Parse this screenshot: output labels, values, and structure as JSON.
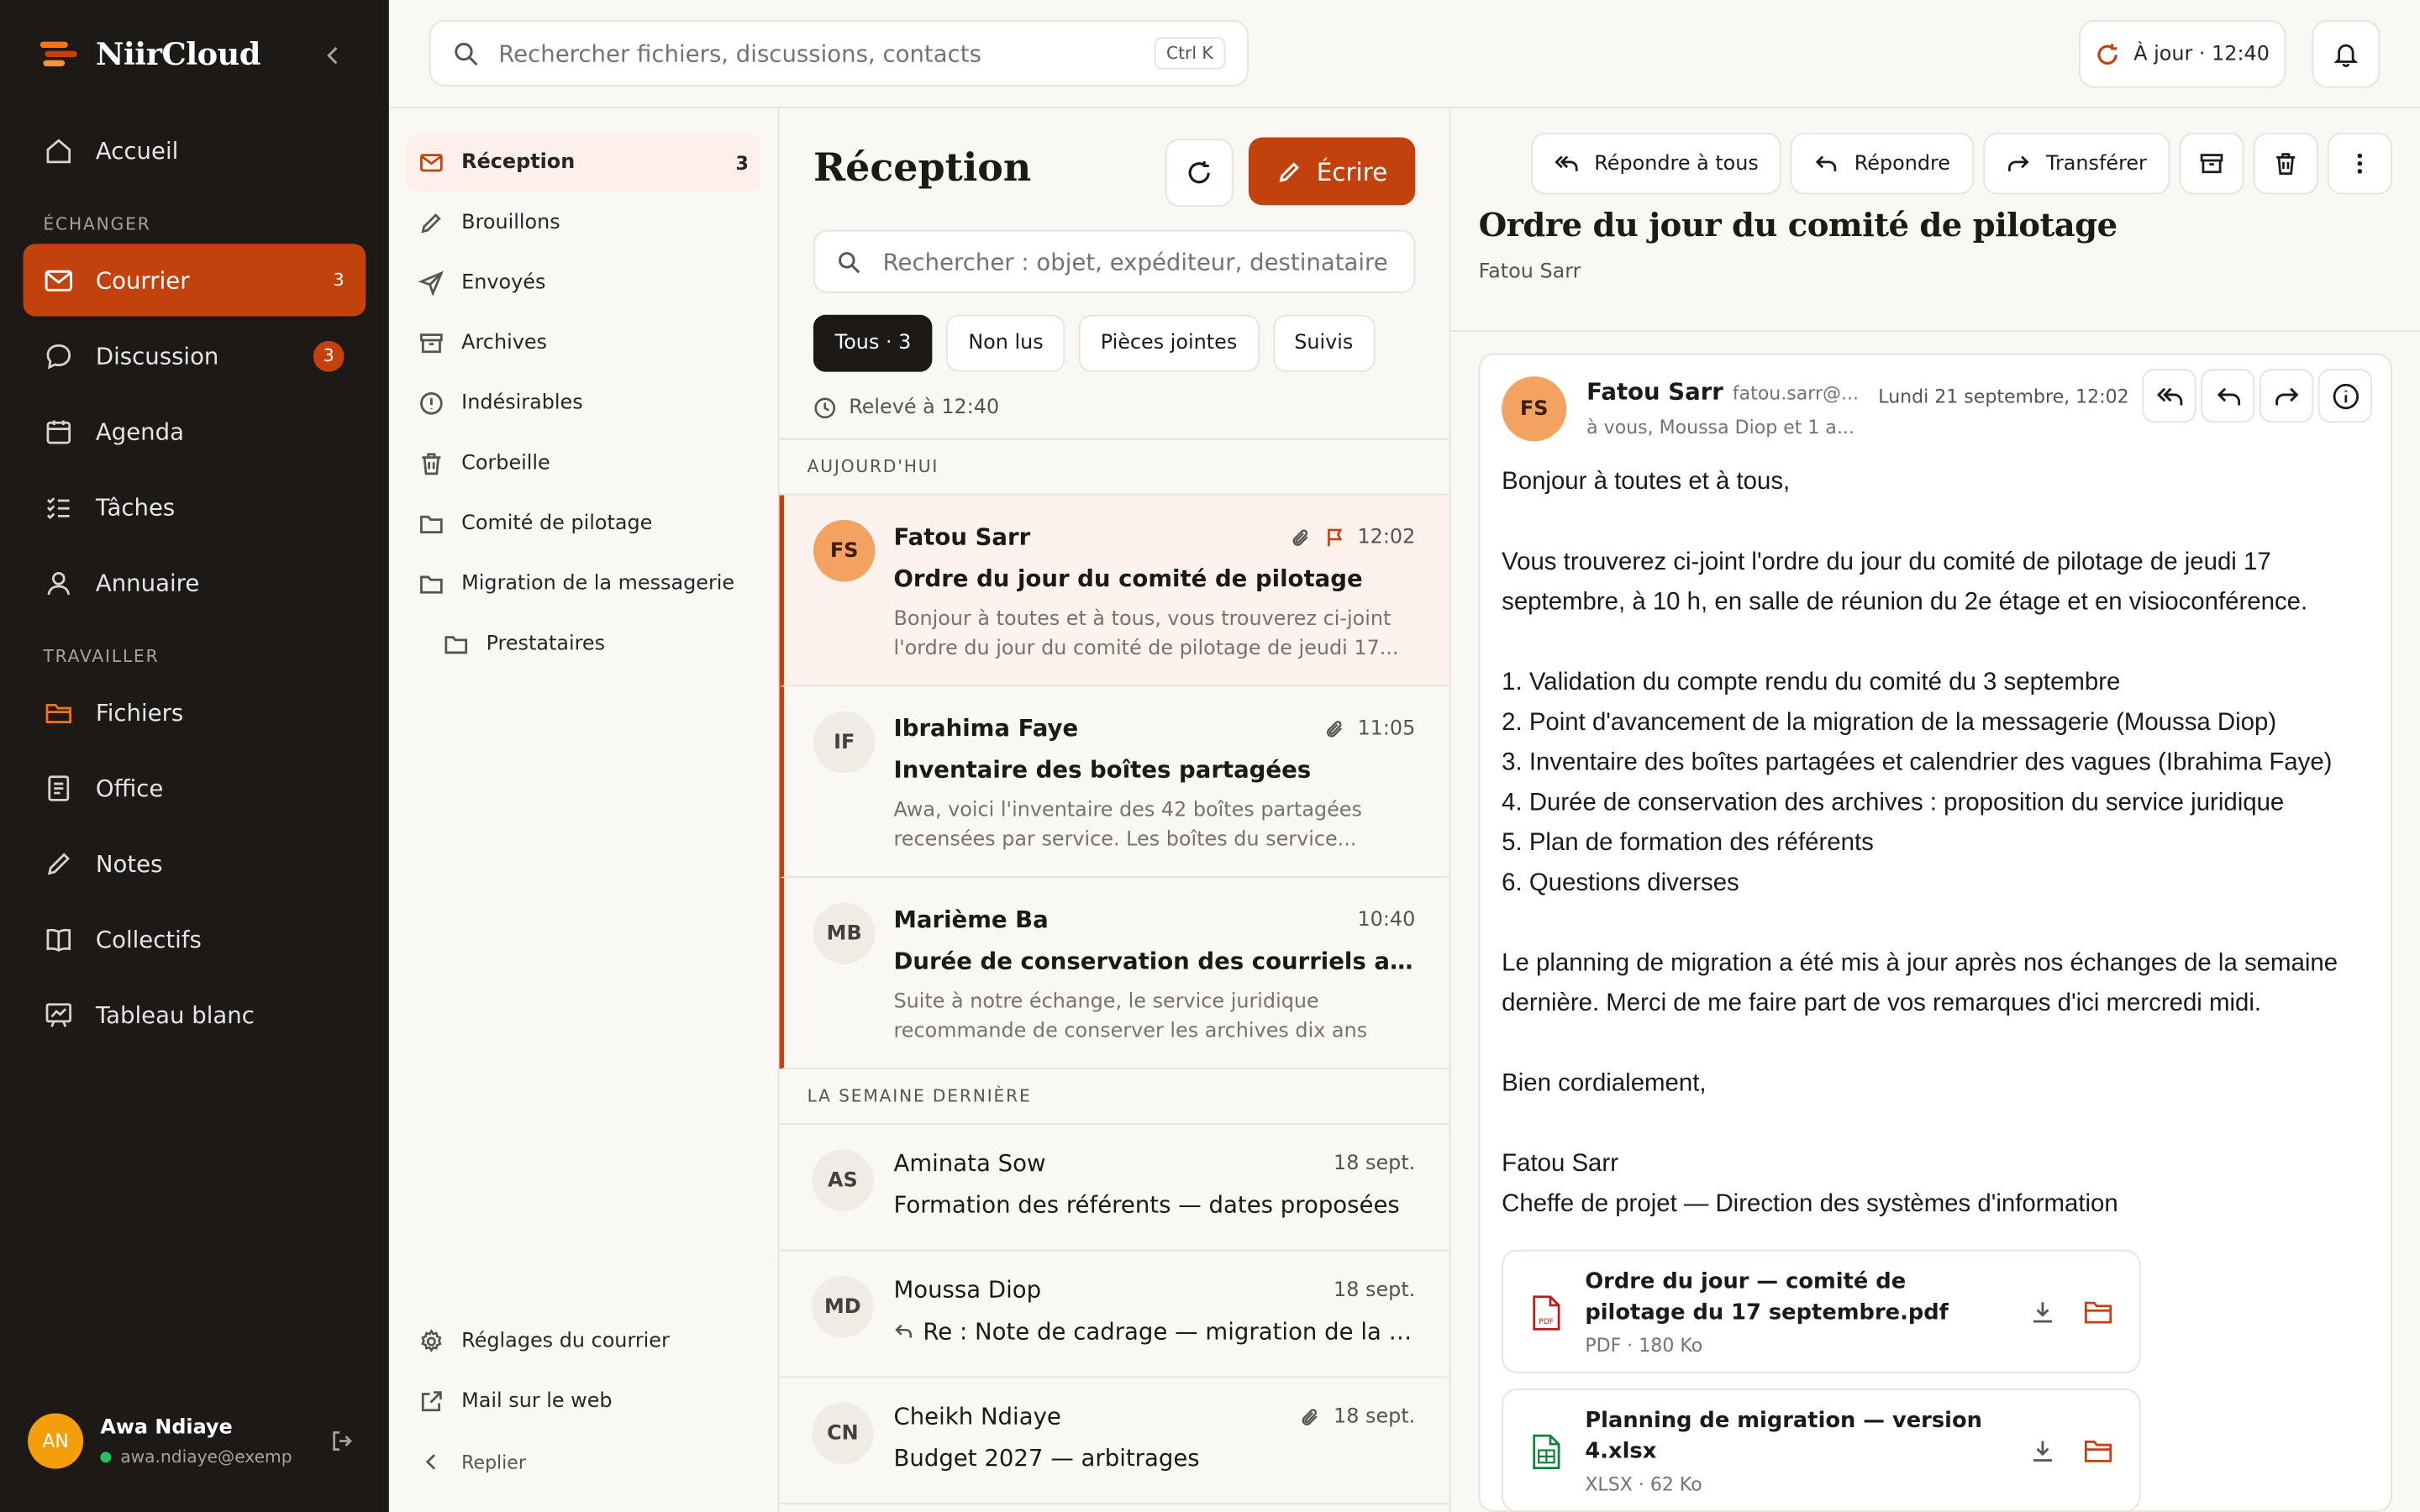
{
  "app": {
    "name": "NiirCloud"
  },
  "sidebar": {
    "items_top": [
      {
        "label": "Accueil"
      }
    ],
    "section_exchange": "ÉCHANGER",
    "items_exchange": [
      {
        "label": "Courrier",
        "badge": "3"
      },
      {
        "label": "Discussion",
        "badge": "3"
      },
      {
        "label": "Agenda"
      },
      {
        "label": "Tâches"
      },
      {
        "label": "Annuaire"
      }
    ],
    "section_work": "TRAVAILLER",
    "items_work": [
      {
        "label": "Fichiers"
      },
      {
        "label": "Office"
      },
      {
        "label": "Notes"
      },
      {
        "label": "Collectifs"
      },
      {
        "label": "Tableau blanc"
      }
    ],
    "user": {
      "initials": "AN",
      "name": "Awa Ndiaye",
      "email": "awa.ndiaye@exemple.sn"
    }
  },
  "topbar": {
    "search_placeholder": "Rechercher fichiers, discussions, contacts",
    "shortcut": "Ctrl K",
    "sync_status": "À jour · 12:40"
  },
  "folders": {
    "items": [
      {
        "label": "Réception",
        "count": "3"
      },
      {
        "label": "Brouillons"
      },
      {
        "label": "Envoyés"
      },
      {
        "label": "Archives"
      },
      {
        "label": "Indésirables"
      },
      {
        "label": "Corbeille"
      },
      {
        "label": "Comité de pilotage"
      },
      {
        "label": "Migration de la messagerie"
      },
      {
        "label": "Prestataires"
      }
    ],
    "settings": "Réglages du courrier",
    "webmail": "Mail sur le web",
    "fold": "Replier"
  },
  "list": {
    "title": "Réception",
    "compose": "Écrire",
    "search_placeholder": "Rechercher : objet, expéditeur, destinataire",
    "filters": [
      "Tous · 3",
      "Non lus",
      "Pièces jointes",
      "Suivis"
    ],
    "fetched": "Relevé à 12:40",
    "group_today": "AUJOURD'HUI",
    "group_last_week": "LA SEMAINE DERNIÈRE",
    "messages": [
      {
        "initials": "FS",
        "from": "Fatou Sarr",
        "time": "12:02",
        "subject": "Ordre du jour du comité de pilotage",
        "preview": "Bonjour à toutes et à tous, vous trouverez ci-joint l'ordre du jour du comité de pilotage de jeudi 17..."
      },
      {
        "initials": "IF",
        "from": "Ibrahima Faye",
        "time": "11:05",
        "subject": "Inventaire des boîtes partagées",
        "preview": "Awa, voici l'inventaire des 42 boîtes partagées recensées par service. Les boîtes du service..."
      },
      {
        "initials": "MB",
        "from": "Marième Ba",
        "time": "10:40",
        "subject": "Durée de conservation des courriels archivés",
        "preview": "Suite à notre échange, le service juridique recommande de conserver les archives dix ans pour..."
      },
      {
        "initials": "AS",
        "from": "Aminata Sow",
        "time": "18 sept.",
        "subject": "Formation des référents — dates proposées"
      },
      {
        "initials": "MD",
        "from": "Moussa Diop",
        "time": "18 sept.",
        "subject": "Re : Note de cadrage — migration de la messagerie"
      },
      {
        "initials": "CN",
        "from": "Cheikh Ndiaye",
        "time": "18 sept.",
        "subject": "Budget 2027 — arbitrages"
      }
    ]
  },
  "reader": {
    "actions": {
      "reply_all": "Répondre à tous",
      "reply": "Répondre",
      "forward": "Transférer"
    },
    "title": "Ordre du jour du comité de pilotage",
    "subtitle": "Fatou Sarr",
    "card": {
      "initials": "FS",
      "from": "Fatou Sarr",
      "email": "fatou.sarr@...",
      "to": "à vous, Moussa Diop et 1 a...",
      "date": "Lundi 21 septembre, 12:02"
    },
    "body": {
      "greeting": "Bonjour à toutes et à tous,",
      "intro": "Vous trouverez ci-joint l'ordre du jour du comité de pilotage de jeudi 17 septembre, à 10 h, en salle de réunion du 2e étage et en visioconférence.",
      "items": [
        "1. Validation du compte rendu du comité du 3 septembre",
        "2. Point d'avancement de la migration de la messagerie (Moussa Diop)",
        "3. Inventaire des boîtes partagées et calendrier des vagues (Ibrahima Faye)",
        "4. Durée de conservation des archives : proposition du service juridique",
        "5. Plan de formation des référents",
        "6. Questions diverses"
      ],
      "closing": "Le planning de migration a été mis à jour après nos échanges de la semaine dernière. Merci de me faire part de vos remarques d'ici mercredi midi.",
      "regards": "Bien cordialement,",
      "signature_name": "Fatou Sarr",
      "signature_title": "Cheffe de projet — Direction des systèmes d'information"
    },
    "attachments": [
      {
        "name": "Ordre du jour — comité de pilotage du 17 septembre.pdf",
        "meta": "PDF · 180 Ko"
      },
      {
        "name": "Planning de migration — version 4.xlsx",
        "meta": "XLSX · 62 Ko"
      }
    ]
  }
}
